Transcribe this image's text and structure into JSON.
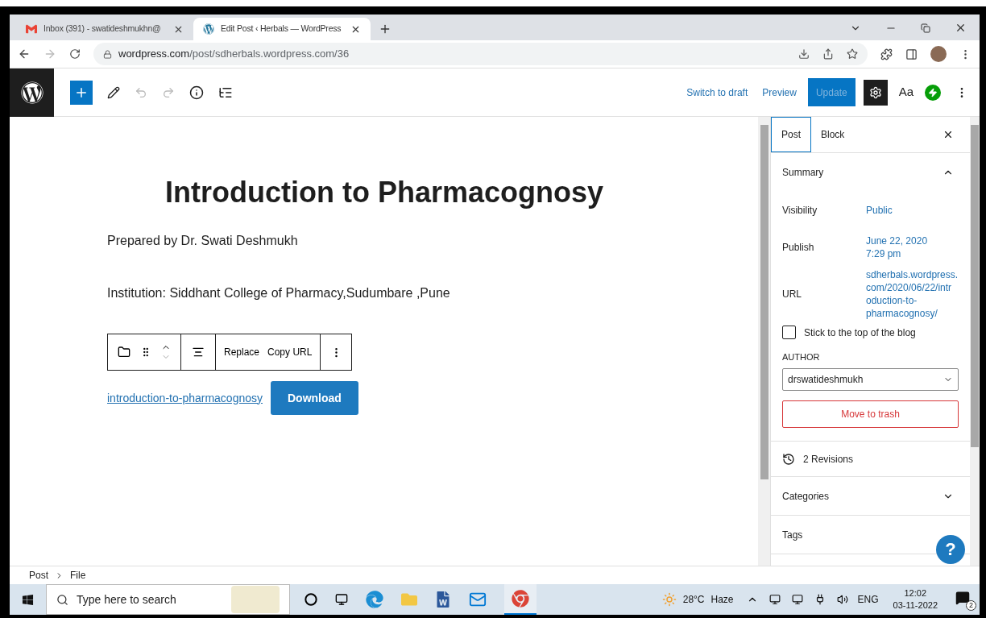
{
  "browser": {
    "tabs": [
      {
        "title": "Inbox (391) - swatideshmukhn@",
        "selected": false,
        "kind": "mail"
      },
      {
        "title": "Edit Post ‹ Herbals — WordPress",
        "selected": true,
        "kind": "wp"
      }
    ],
    "url_host": "wordpress.com",
    "url_path": "/post/sdherbals.wordpress.com/36"
  },
  "editor_toolbar": {
    "switch_to_draft": "Switch to draft",
    "preview": "Preview",
    "update": {
      "label": "Update",
      "disabled": true
    },
    "text_styles": "Aa"
  },
  "post": {
    "title": "Introduction to Pharmacognosy",
    "paragraphs": [
      "Prepared by Dr. Swati Deshmukh",
      "Institution: Siddhant College of Pharmacy,Sudumbare ,Pune"
    ],
    "block_toolbar": {
      "actions": [
        "Replace",
        "Copy URL"
      ]
    },
    "file_link": "introduction-to-pharmacognosy",
    "download": "Download"
  },
  "sidebar": {
    "tabs": [
      {
        "label": "Post",
        "selected": true
      },
      {
        "label": "Block",
        "selected": false
      }
    ],
    "summary": {
      "title": "Summary",
      "expanded": true,
      "rows": [
        {
          "label": "Visibility",
          "value": "Public"
        },
        {
          "label": "Publish",
          "value": "June 22, 2020\n7:29 pm"
        },
        {
          "label": "URL",
          "value": "sdherbals.wordpress.\ncom/2020/06/22/intr\noduction-to-\npharmacognosy/"
        }
      ],
      "sticky": {
        "label": "Stick to the top of the blog",
        "checked": false
      },
      "author_label": "AUTHOR",
      "author": "drswatideshmukh",
      "trash": "Move to trash"
    },
    "revisions": "2 Revisions",
    "panels": [
      {
        "title": "Categories",
        "expanded": false
      },
      {
        "title": "Tags"
      }
    ],
    "help": "?"
  },
  "breadcrumb": [
    "Post",
    "File"
  ],
  "taskbar": {
    "search_placeholder": "Type here to search",
    "temperature": "28°C",
    "weather": "Haze",
    "language": "ENG",
    "time": "12:02",
    "date": "03-11-2022",
    "notifications": "2"
  }
}
